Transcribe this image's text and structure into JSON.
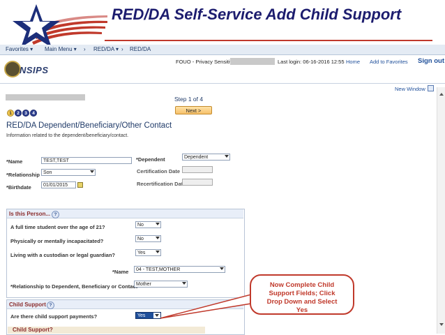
{
  "slide": {
    "title": "RED/DA Self-Service Add Child Support"
  },
  "navbar": {
    "favorites": "Favorites ▾",
    "main_menu": "Main Menu ▾",
    "sep1": "›",
    "redda_menu": "RED/DA ▾",
    "sep2": "›",
    "crumb": "RED/DA"
  },
  "header": {
    "fouo": "FOUO - Privacy Sensitive:",
    "last_login": "Last login: 06-16-2016 12:55",
    "home": "Home",
    "add_favorites": "Add to Favorites",
    "sign_out": "Sign out",
    "logo_text": "NSIPS"
  },
  "toolbar": {
    "new_window": "New Window"
  },
  "wizard": {
    "step_label": "Step 1 of 4",
    "next_label": "Next >",
    "steps": [
      "1",
      "2",
      "3",
      "4"
    ]
  },
  "page": {
    "title": "RED/DA Dependent/Beneficiary/Other Contact",
    "subtitle": "Information related to the dependent/beneficiary/contact."
  },
  "form": {
    "name_label": "*Name",
    "name_value": "TEST,TEST",
    "relationship_label": "*Relationship",
    "relationship_value": "Son",
    "birthdate_label": "*Birthdate",
    "birthdate_value": "01/01/2015",
    "dependent_label": "*Dependent",
    "dependent_value": "Dependent",
    "cert_date_label": "Certification Date",
    "recert_date_label": "Recertification Date"
  },
  "is_this_person": {
    "title": "Is this Person...",
    "q1": "A full time student over the age of 21?",
    "a1": "No",
    "q2": "Physically or mentally incapacitated?",
    "a2": "No",
    "q3": "Living with a custodian or legal guardian?",
    "a3": "Yes",
    "name_label": "*Name",
    "name_value": "04 - TEST,MOTHER",
    "rel_label": "*Relationship to Dependent, Beneficiary or Contact",
    "rel_value": "Mother"
  },
  "child_support": {
    "title": "Child Support",
    "question": "Are there child support payments?",
    "answer": "Yes",
    "sub_title": "Child Support?"
  },
  "callout": {
    "text": "Now Complete Child Support Fields; Click Drop Down and Select Yes"
  },
  "colors": {
    "title": "#1c1c6e",
    "callout": "#c0392b",
    "section_title": "#8b2d2d"
  },
  "help_glyph": "?"
}
